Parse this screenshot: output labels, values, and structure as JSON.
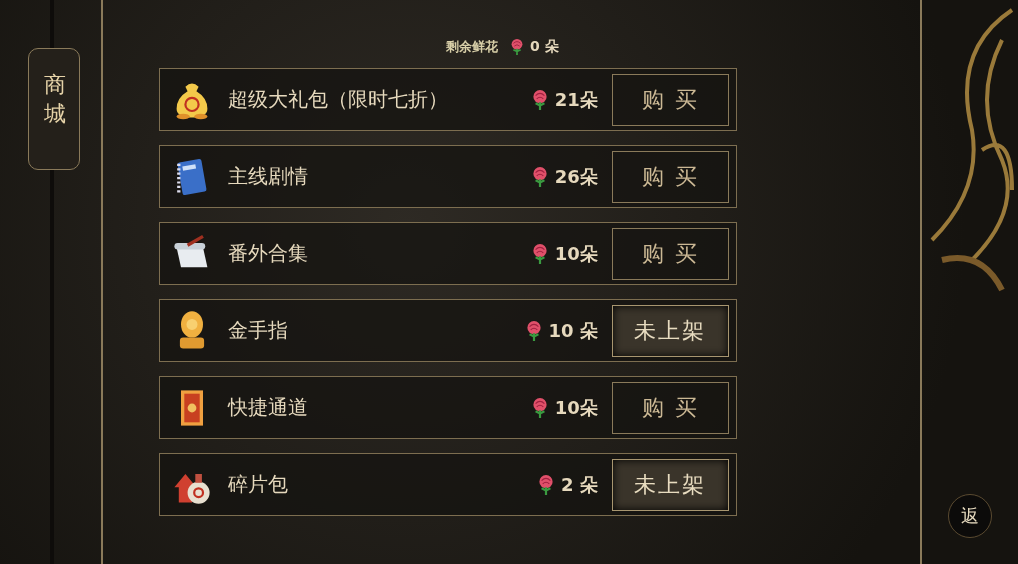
{
  "sidebar": {
    "tab": {
      "label": "商城",
      "selected": true
    }
  },
  "balance": {
    "label": "剩余鲜花",
    "amount": "0 朵"
  },
  "items": [
    {
      "name": "超级大礼包（限时七折）",
      "price": "21朵",
      "kind": "buy",
      "button": "购 买"
    },
    {
      "name": "主线剧情",
      "price": "26朵",
      "kind": "buy",
      "button": "购 买"
    },
    {
      "name": "番外合集",
      "price": "10朵",
      "kind": "buy",
      "button": "购 买"
    },
    {
      "name": "金手指",
      "price": "10 朵",
      "kind": "unlisted",
      "button": "未上架"
    },
    {
      "name": "快捷通道",
      "price": "10朵",
      "kind": "buy",
      "button": "购 买"
    },
    {
      "name": "碎片包",
      "price": "2 朵",
      "kind": "unlisted",
      "button": "未上架"
    }
  ],
  "back": {
    "label": "返"
  }
}
